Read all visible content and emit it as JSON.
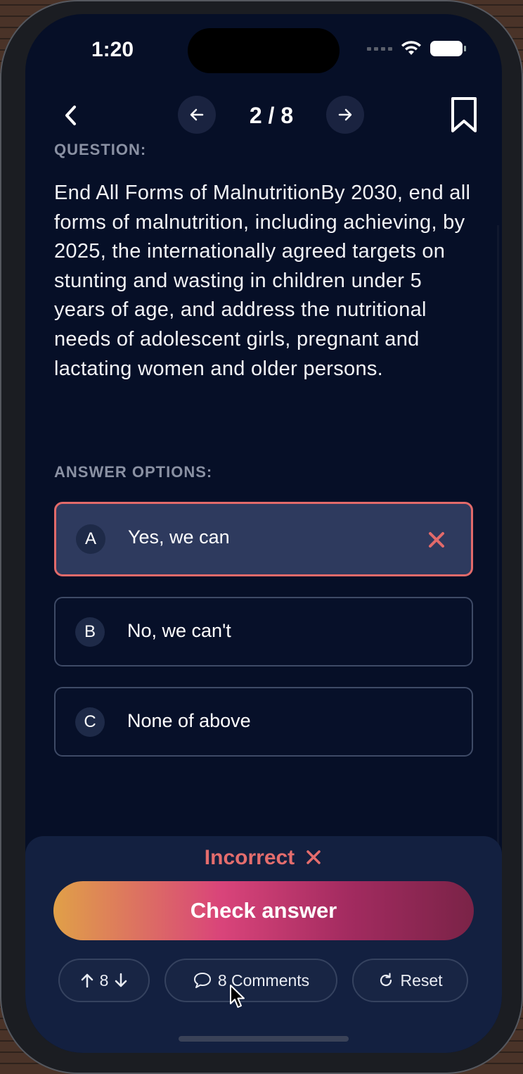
{
  "status_bar": {
    "time": "1:20"
  },
  "nav": {
    "counter": "2 / 8"
  },
  "question": {
    "label": "QUESTION:",
    "text": "End All Forms of MalnutritionBy 2030, end all forms of malnutrition, including achieving, by 2025, the internationally agreed targets on stunting and wasting in children under 5 years of age, and address the nutritional needs of adolescent girls, pregnant and lactating women and older persons."
  },
  "answers": {
    "label": "ANSWER OPTIONS:",
    "options": [
      {
        "letter": "A",
        "text": "Yes, we can",
        "state": "incorrect-selected"
      },
      {
        "letter": "B",
        "text": "No, we can't",
        "state": "default"
      },
      {
        "letter": "C",
        "text": "None of above",
        "state": "default"
      }
    ]
  },
  "result": {
    "text": "Incorrect",
    "color": "#e46d6d"
  },
  "actions": {
    "check_label": "Check answer",
    "votes": "8",
    "comments_label": "8 Comments",
    "reset_label": "Reset"
  },
  "icons": [
    "back-chevron-icon",
    "arrow-left-icon",
    "arrow-right-icon",
    "bookmark-icon",
    "close-icon",
    "arrow-up-icon",
    "arrow-down-icon",
    "comment-bubble-icon",
    "refresh-icon",
    "cursor-icon"
  ],
  "colors": {
    "background": "#060f27",
    "accent_error": "#e26a6a",
    "panel": "#132040"
  }
}
